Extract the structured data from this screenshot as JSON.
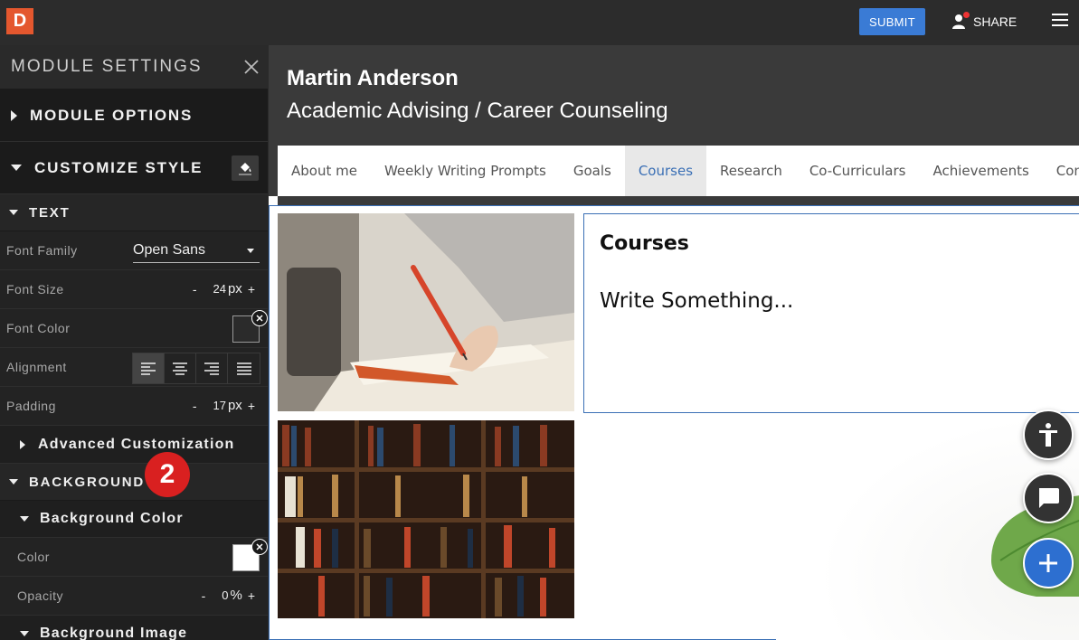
{
  "topbar": {
    "logo_letter": "D",
    "submit_label": "SUBMIT",
    "share_label": "SHARE",
    "accent": "#3a7bd5",
    "logo_color": "#e4572e"
  },
  "sidebar": {
    "title": "MODULE SETTINGS",
    "module_options": "MODULE OPTIONS",
    "customize_style": "CUSTOMIZE STYLE",
    "text_section": "TEXT",
    "font_family_label": "Font Family",
    "font_family_value": "Open Sans",
    "font_size_label": "Font Size",
    "font_size_value": "24",
    "font_size_unit": "px",
    "font_color_label": "Font Color",
    "font_color_value": "#2b2b2b",
    "alignment_label": "Alignment",
    "alignment_selected": "left",
    "padding_label": "Padding",
    "padding_value": "17",
    "padding_unit": "px",
    "advanced_label": "Advanced Customization",
    "background_section": "BACKGROUND",
    "step_badge": "2",
    "bg_color_section": "Background Color",
    "color_label": "Color",
    "color_value": "#ffffff",
    "opacity_label": "Opacity",
    "opacity_value": "0",
    "opacity_unit": "%",
    "bg_image_section": "Background Image",
    "minus": "-",
    "plus": "+"
  },
  "main": {
    "name": "Martin Anderson",
    "subtitle": "Academic Advising / Career Counseling",
    "nav": [
      {
        "label": "About me",
        "active": false
      },
      {
        "label": "Weekly Writing Prompts",
        "active": false
      },
      {
        "label": "Goals",
        "active": false
      },
      {
        "label": "Courses",
        "active": true
      },
      {
        "label": "Research",
        "active": false
      },
      {
        "label": "Co-Curriculars",
        "active": false
      },
      {
        "label": "Achievements",
        "active": false
      },
      {
        "label": "Con",
        "active": false
      }
    ],
    "textbox_title": "Courses",
    "textbox_body": "Write Something..."
  }
}
